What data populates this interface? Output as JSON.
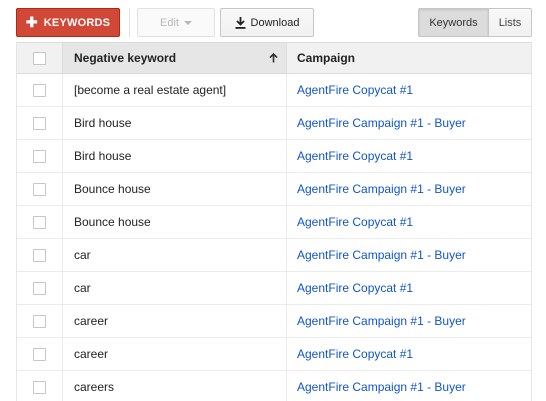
{
  "toolbar": {
    "add_keywords_label": "KEYWORDS",
    "add_icon": "plus-icon",
    "edit_label": "Edit",
    "download_label": "Download",
    "download_icon": "download-icon",
    "view_toggle": {
      "options": [
        "Keywords",
        "Lists"
      ],
      "selected": "Keywords"
    }
  },
  "table": {
    "columns": {
      "keyword": "Negative keyword",
      "campaign": "Campaign"
    },
    "sort": {
      "column": "keyword",
      "direction": "ascending"
    },
    "rows": [
      {
        "keyword": "[become a real estate agent]",
        "campaign": "AgentFire Copycat #1"
      },
      {
        "keyword": "Bird house",
        "campaign": "AgentFire Campaign #1 - Buyer"
      },
      {
        "keyword": "Bird house",
        "campaign": "AgentFire Copycat #1"
      },
      {
        "keyword": "Bounce house",
        "campaign": "AgentFire Campaign #1 - Buyer"
      },
      {
        "keyword": "Bounce house",
        "campaign": "AgentFire Copycat #1"
      },
      {
        "keyword": "car",
        "campaign": "AgentFire Campaign #1 - Buyer"
      },
      {
        "keyword": "car",
        "campaign": "AgentFire Copycat #1"
      },
      {
        "keyword": "career",
        "campaign": "AgentFire Campaign #1 - Buyer"
      },
      {
        "keyword": "career",
        "campaign": "AgentFire Copycat #1"
      },
      {
        "keyword": "careers",
        "campaign": "AgentFire Campaign #1 - Buyer"
      }
    ]
  },
  "colors": {
    "primary_button": "#d14836",
    "link": "#1155cc",
    "header_bg": "#f1f1f1"
  }
}
